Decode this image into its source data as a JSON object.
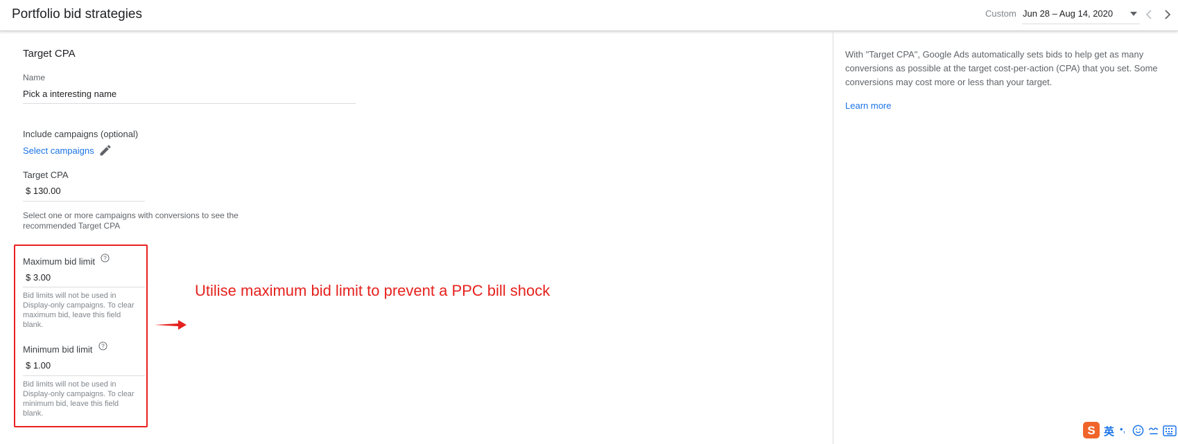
{
  "header": {
    "title": "Portfolio bid strategies",
    "date_label": "Custom",
    "date_range": "Jun 28 – Aug 14, 2020"
  },
  "form": {
    "section_title": "Target CPA",
    "name_label": "Name",
    "name_value": "Pick a interesting name",
    "include_label": "Include campaigns (optional)",
    "select_campaigns": "Select campaigns",
    "target_cpa_label": "Target CPA",
    "target_cpa_value": "$ 130.00",
    "recommend_hint_line1": "Select one or more campaigns with conversions to see the",
    "recommend_hint_line2": "recommended Target CPA",
    "max_bid_label": "Maximum bid limit",
    "max_bid_value": "$ 3.00",
    "max_bid_hint_lines": [
      "Bid limits will not be used in",
      "Display-only campaigns. To clear",
      "maximum bid, leave this field",
      "blank."
    ],
    "min_bid_label": "Minimum bid limit",
    "min_bid_value": "$ 1.00",
    "min_bid_hint_lines": [
      "Bid limits will not be used in",
      "Display-only campaigns. To clear",
      "minimum bid, leave this field",
      "blank."
    ]
  },
  "side": {
    "help_line1": "With \"Target CPA\", Google Ads automatically sets bids to help get as many",
    "help_line2": "conversions as possible at the target cost-per-action (CPA) that you set. Some",
    "help_line3": "conversions may cost more or less than your target.",
    "learn_more": "Learn more"
  },
  "annotation": {
    "text": "Utilise maximum bid limit to prevent a PPC bill shock",
    "color": "#e5211d"
  },
  "ime": {
    "lang": "英",
    "punct": "•,"
  },
  "colors": {
    "link": "#1a73e8",
    "annotation": "#e5211d"
  }
}
